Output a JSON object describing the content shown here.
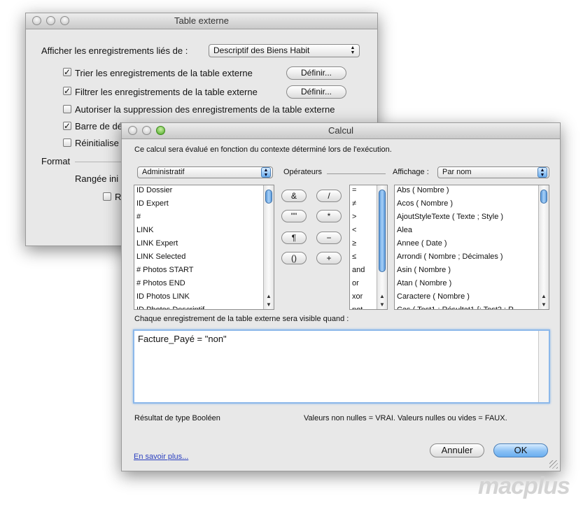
{
  "back": {
    "title": "Table externe",
    "show_label": "Afficher les enregistrements liés de :",
    "show_value": "Descriptif des Biens Habit",
    "sort_label": "Trier les enregistrements de la table externe",
    "filter_label": "Filtrer les enregistrements de la table externe",
    "define_label": "Définir...",
    "allow_delete_label": "Autoriser la suppression des enregistrements de la table externe",
    "scrollbar_label": "Barre de dé",
    "reset_label": "Réinitialise",
    "format_label": "Format",
    "initial_row_label": "Rangée ini",
    "partial_label": "R",
    "check_mark": "✓"
  },
  "dialog": {
    "title": "Calcul",
    "intro": "Ce calcul sera évalué en fonction du contexte déterminé lors de l'exécution.",
    "table_select": "Administratif",
    "operators_label": "Opérateurs",
    "display_label": "Affichage :",
    "display_value": "Par nom",
    "fields": [
      "ID Dossier",
      "ID Expert",
      "#",
      "LINK",
      "LINK Expert",
      "LINK Selected",
      "# Photos START",
      "# Photos END",
      "ID Photos LINK",
      "ID Photos Descriptif"
    ],
    "operator_buttons": [
      "&",
      "/",
      "\"\"",
      "*",
      "¶",
      "−",
      "()",
      "+"
    ],
    "comparison_ops": [
      "=",
      "≠",
      ">",
      "<",
      "≥",
      "≤",
      "and",
      "or",
      "xor",
      "not"
    ],
    "functions": [
      "Abs ( Nombre )",
      "Acos ( Nombre )",
      "AjoutStyleTexte ( Texte ; Style )",
      "Alea",
      "Annee ( Date )",
      "Arrondi ( Nombre ; Décimales )",
      "Asin ( Nombre )",
      "Atan ( Nombre )",
      "Caractere ( Nombre )",
      "Cas ( Test1 ; Résultat1 {; Test2 ; R"
    ],
    "condition_label": "Chaque enregistrement de la table externe sera visible quand :",
    "formula": "Facture_Payé = \"non\"",
    "result_type": "Résultat de type Booléen",
    "values_note": "Valeurs non nulles = VRAI. Valeurs nulles ou vides = FAUX.",
    "learn_more": "En savoir plus...",
    "cancel_label": "Annuler",
    "ok_label": "OK"
  },
  "watermark": "macplus"
}
